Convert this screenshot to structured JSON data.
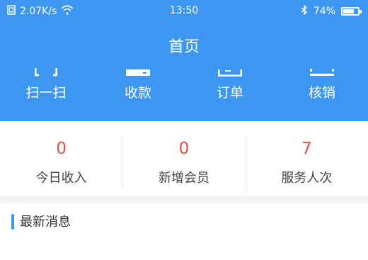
{
  "status": {
    "speed": "2.07K/s",
    "time": "13:50",
    "battery": "74%",
    "battery_level": 0.74
  },
  "header": {
    "title": "首页"
  },
  "actions": [
    {
      "label": "扫一扫",
      "icon": "scan-icon"
    },
    {
      "label": "收款",
      "icon": "payment-icon"
    },
    {
      "label": "订单",
      "icon": "order-icon"
    },
    {
      "label": "核销",
      "icon": "verify-icon"
    }
  ],
  "stats": [
    {
      "value": "0",
      "label": "今日收入"
    },
    {
      "value": "0",
      "label": "新增会员"
    },
    {
      "value": "7",
      "label": "服务人次"
    }
  ],
  "news": {
    "title": "最新消息"
  },
  "colors": {
    "primary": "#3d97f2",
    "value": "#e0504a"
  }
}
